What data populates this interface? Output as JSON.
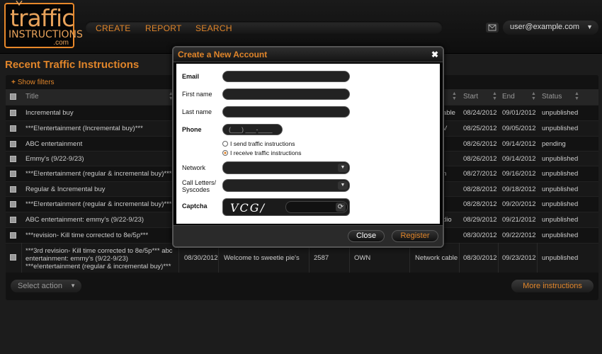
{
  "logo": {
    "line1": "traffic",
    "line2": "INSTRUCTIONS",
    "line3": ".com"
  },
  "nav": {
    "items": [
      "CREATE",
      "REPORT",
      "SEARCH"
    ]
  },
  "user": {
    "email": "user@example.com"
  },
  "page": {
    "title": "Recent Traffic Instructions",
    "show_filters": "Show filters"
  },
  "table": {
    "headers": {
      "title": "Title",
      "network": "e",
      "start": "Start",
      "end": "End",
      "status": "Status"
    },
    "rows": [
      {
        "title": "Incremental buy",
        "network": "able",
        "start": "08/24/2012",
        "end": "09/01/2012",
        "status": "unpublished"
      },
      {
        "title": "***E!entertainment (Incremental buy)***",
        "network": "V",
        "start": "08/25/2012",
        "end": "09/05/2012",
        "status": "unpublished"
      },
      {
        "title": "ABC  entertainment",
        "network": "",
        "start": "08/26/2012",
        "end": "09/14/2012",
        "status": "pending"
      },
      {
        "title": "Emmy's (9/22-9/23)",
        "network": "",
        "start": "08/26/2012",
        "end": "09/14/2012",
        "status": "unpublished"
      },
      {
        "title": "***E!entertainment (regular & incremental buy)***",
        "network": "n",
        "start": "08/27/2012",
        "end": "09/16/2012",
        "status": "unpublished"
      },
      {
        "title": "Regular & Incremental buy",
        "network": "",
        "start": "08/28/2012",
        "end": "09/18/2012",
        "status": "unpublished"
      },
      {
        "title": "***E!entertainment (regular & incremental buy)***",
        "network": "",
        "start": "08/28/2012",
        "end": "09/20/2012",
        "status": "unpublished"
      },
      {
        "title": "ABC  entertainment: emmy's (9/22-9/23)",
        "network": "dio",
        "start": "08/29/2012",
        "end": "09/21/2012",
        "status": "unpublished"
      },
      {
        "title": "***revision- Kill time corrected to 8e/5p***",
        "network": "",
        "start": "08/30/2012",
        "end": "09/22/2012",
        "status": "unpublished"
      }
    ],
    "last_row": {
      "title": "***3rd revision- Kill time corrected to 8e/5p*** abc entertainment: emmy's (9/22-9/23) ***e!entertainment (regular & incremental buy)***",
      "date": "08/30/2012",
      "description": "Welcome to sweetie pie's",
      "code": "2587",
      "channel": "OWN",
      "network": "Network cable",
      "start": "08/30/2012",
      "end": "09/23/2012",
      "status": "unpublished"
    }
  },
  "actions": {
    "select_action": "Select action",
    "more": "More instructions"
  },
  "modal": {
    "title": "Create a New Account",
    "labels": {
      "email": "Email",
      "first_name": "First name",
      "last_name": "Last name",
      "phone": "Phone",
      "network": "Network",
      "call_letters": "Call Letters/ Syscodes",
      "captcha": "Captcha"
    },
    "phone_placeholder": "(___) ___-____",
    "radio_send": "I send traffic instructions",
    "radio_receive": "I receive traffic instructions",
    "radio_selected": "receive",
    "captcha_text": "VCG/",
    "close_label": "Close",
    "register_label": "Register"
  },
  "colors": {
    "accent": "#e0852a",
    "background": "#1c1c1c",
    "modal_body": "#ffffff"
  },
  "icons": {
    "mail": "mail-icon",
    "close": "close-icon",
    "refresh": "refresh-icon",
    "caret": "chevron-down-icon"
  }
}
